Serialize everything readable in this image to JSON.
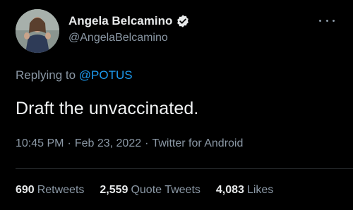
{
  "author": {
    "display_name": "Angela Belcamino",
    "handle": "@AngelaBelcamino",
    "verified": true,
    "verified_color": "#e7e9ea"
  },
  "reply": {
    "prefix": "Replying to",
    "mention": "@POTUS"
  },
  "tweet": {
    "text": "Draft the unvaccinated."
  },
  "meta": {
    "time": "10:45 PM",
    "date": "Feb 23, 2022",
    "source": "Twitter for Android",
    "separator": "·"
  },
  "stats": {
    "retweets": {
      "count": "690",
      "label": "Retweets"
    },
    "quote_tweets": {
      "count": "2,559",
      "label": "Quote Tweets"
    },
    "likes": {
      "count": "4,083",
      "label": "Likes"
    }
  },
  "icons": {
    "verified": "verified-badge-icon",
    "more": "more-options-icon"
  },
  "colors": {
    "background": "#000000",
    "primary_text": "#e7e9ea",
    "secondary_text": "#8b98a5",
    "link": "#1d9bf0",
    "divider": "#2f3336"
  }
}
